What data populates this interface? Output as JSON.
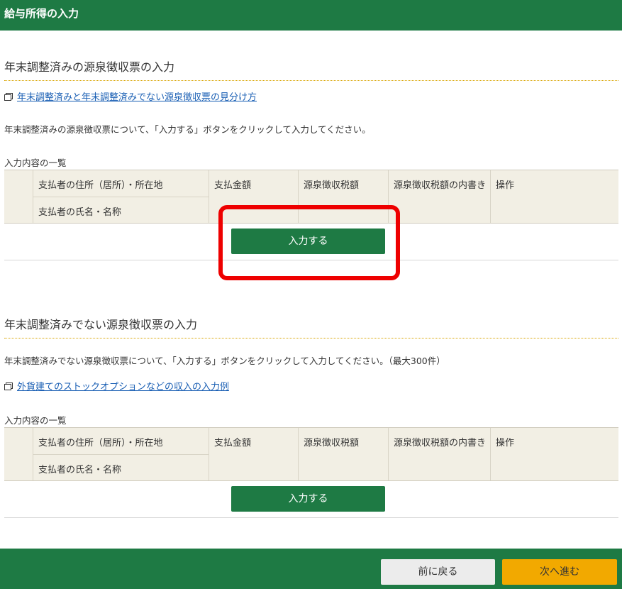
{
  "header": {
    "title": "給与所得の入力"
  },
  "section1": {
    "title": "年末調整済みの源泉徴収票の入力",
    "link": "年末調整済みと年末調整済みでない源泉徴収票の見分け方",
    "description": "年末調整済みの源泉徴収票について、「入力する」ボタンをクリックして入力してください。",
    "list_label": "入力内容の一覧",
    "table": {
      "col_address": "支払者の住所（居所）・所在地",
      "col_name": "支払者の氏名・名称",
      "col_amount": "支払金額",
      "col_tax": "源泉徴収税額",
      "col_tax_detail": "源泉徴収税額の内書き",
      "col_action": "操作"
    },
    "input_button": "入力する"
  },
  "section2": {
    "title": "年末調整済みでない源泉徴収票の入力",
    "description": "年末調整済みでない源泉徴収票について、「入力する」ボタンをクリックして入力してください。（最大300件）",
    "link": "外貨建てのストックオプションなどの収入の入力例",
    "list_label": "入力内容の一覧",
    "table": {
      "col_address": "支払者の住所（居所）・所在地",
      "col_name": "支払者の氏名・名称",
      "col_amount": "支払金額",
      "col_tax": "源泉徴収税額",
      "col_tax_detail": "源泉徴収税額の内書き",
      "col_action": "操作"
    },
    "input_button": "入力する"
  },
  "footer": {
    "back_button": "前に戻る",
    "next_button": "次へ進む"
  },
  "icons": {
    "link_icon": "new-window-icon"
  },
  "colors": {
    "brand_green": "#1e7a44",
    "next_yellow": "#f2a900",
    "highlight_red": "#ee0000"
  }
}
